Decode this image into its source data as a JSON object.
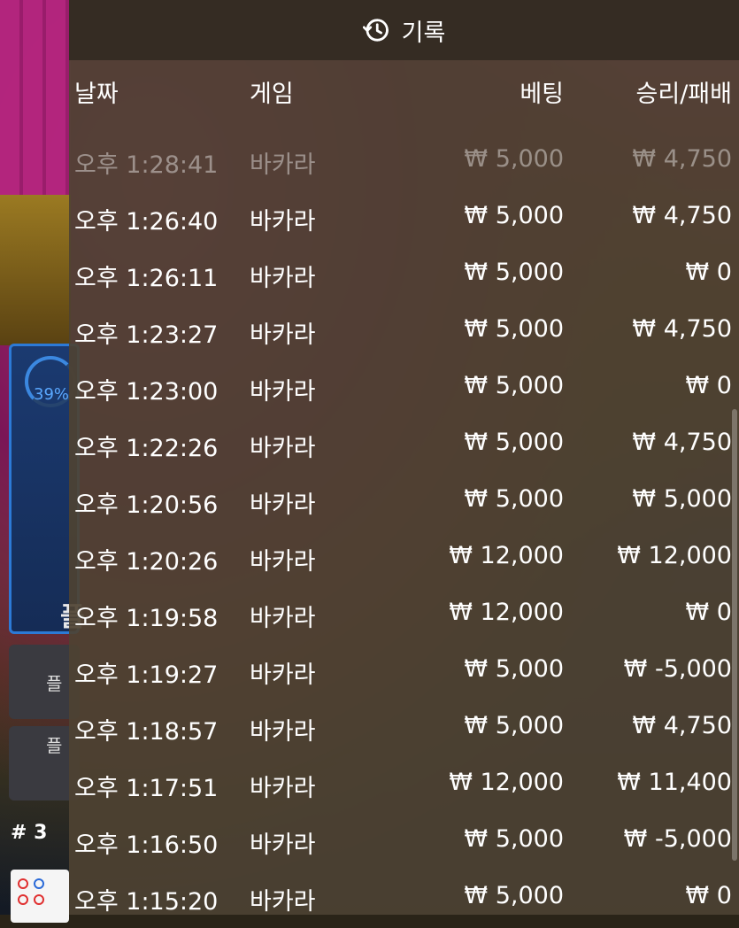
{
  "background": {
    "percent": "39%",
    "big_letter": "플",
    "side_buttons": [
      "플",
      "플"
    ],
    "table_number": "# 3"
  },
  "header": {
    "title": "기록",
    "icon": "history-icon"
  },
  "columns": {
    "date": "날짜",
    "game": "게임",
    "bet": "베팅",
    "winloss": "승리/패배"
  },
  "rows": [
    {
      "time": "오후 1:28:41",
      "game": "바카라",
      "bet": "₩ 5,000",
      "result": "₩ 4,750"
    },
    {
      "time": "오후 1:26:40",
      "game": "바카라",
      "bet": "₩ 5,000",
      "result": "₩ 4,750"
    },
    {
      "time": "오후 1:26:11",
      "game": "바카라",
      "bet": "₩ 5,000",
      "result": "₩ 0"
    },
    {
      "time": "오후 1:23:27",
      "game": "바카라",
      "bet": "₩ 5,000",
      "result": "₩ 4,750"
    },
    {
      "time": "오후 1:23:00",
      "game": "바카라",
      "bet": "₩ 5,000",
      "result": "₩ 0"
    },
    {
      "time": "오후 1:22:26",
      "game": "바카라",
      "bet": "₩ 5,000",
      "result": "₩ 4,750"
    },
    {
      "time": "오후 1:20:56",
      "game": "바카라",
      "bet": "₩ 5,000",
      "result": "₩ 5,000"
    },
    {
      "time": "오후 1:20:26",
      "game": "바카라",
      "bet": "₩ 12,000",
      "result": "₩ 12,000"
    },
    {
      "time": "오후 1:19:58",
      "game": "바카라",
      "bet": "₩ 12,000",
      "result": "₩ 0"
    },
    {
      "time": "오후 1:19:27",
      "game": "바카라",
      "bet": "₩ 5,000",
      "result": "₩ -5,000"
    },
    {
      "time": "오후 1:18:57",
      "game": "바카라",
      "bet": "₩ 5,000",
      "result": "₩ 4,750"
    },
    {
      "time": "오후 1:17:51",
      "game": "바카라",
      "bet": "₩ 12,000",
      "result": "₩ 11,400"
    },
    {
      "time": "오후 1:16:50",
      "game": "바카라",
      "bet": "₩ 5,000",
      "result": "₩ -5,000"
    },
    {
      "time": "오후 1:15:20",
      "game": "바카라",
      "bet": "₩ 5,000",
      "result": "₩ 0"
    }
  ]
}
